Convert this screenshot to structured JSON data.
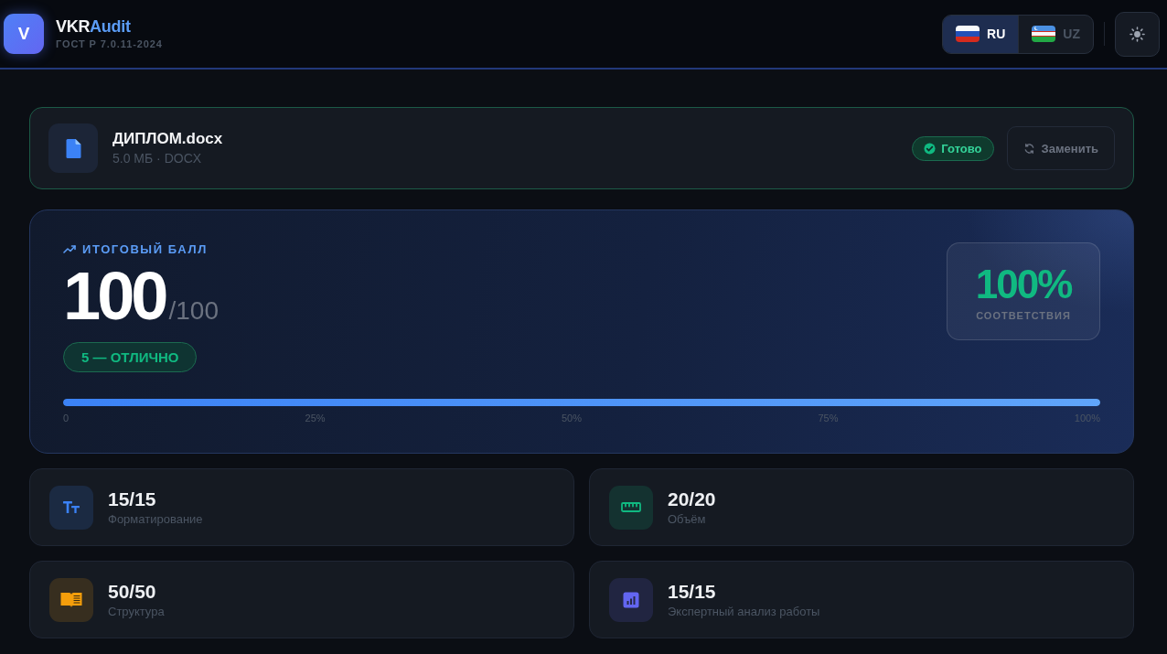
{
  "header": {
    "logo_letter": "V",
    "brand": {
      "main": "VKR",
      "accent": "Audit"
    },
    "subtitle": "ГОСТ Р 7.0.11-2024",
    "languages": [
      {
        "code": "RU",
        "selected": true
      },
      {
        "code": "UZ",
        "selected": false
      }
    ]
  },
  "file": {
    "name": "ДИПЛОМ.docx",
    "meta": "5.0 МБ · DOCX",
    "status": "Готово",
    "replace_button": "Заменить"
  },
  "score": {
    "label": "ИТОГОВЫЙ БАЛЛ",
    "value": "100",
    "max": "/100",
    "grade": "5 — ОТЛИЧНО",
    "compliance": "100%",
    "compliance_label": "СООТВЕТСТВИЯ",
    "level": 1,
    "ticks": [
      "0",
      "25%",
      "50%",
      "75%",
      "100%"
    ]
  },
  "categories": [
    {
      "value": "15/15",
      "label": "Форматирование",
      "color": "#3b82f6"
    },
    {
      "value": "20/20",
      "label": "Объём",
      "color": "#10b981"
    },
    {
      "value": "50/50",
      "label": "Структура",
      "color": "#f59e0b"
    },
    {
      "value": "15/15",
      "label": "Экспертный анализ работы",
      "color": "#6366f1"
    }
  ]
}
